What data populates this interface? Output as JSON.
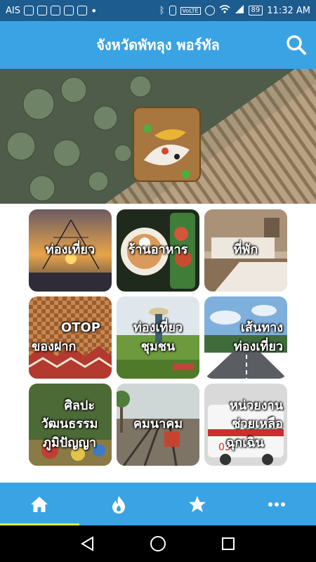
{
  "status": {
    "carrier": "AIS",
    "time": "11:32 AM",
    "battery": "89",
    "network_badge": "VoLTE"
  },
  "app": {
    "title": "จังหวัดพัทลุง พอร์ทัล"
  },
  "icons": {
    "search": "search-icon",
    "home": "home-icon",
    "trending": "flame-icon",
    "favorite": "star-icon",
    "more": "more-icon"
  },
  "menu": [
    {
      "lines": [
        "ท่องเที่ยว"
      ],
      "theme": "sunset"
    },
    {
      "lines": [
        "ร้านอาหาร"
      ],
      "theme": "food"
    },
    {
      "lines": [
        "ที่พัก"
      ],
      "theme": "room"
    },
    {
      "lines": [
        "OTOP",
        "ของฝาก"
      ],
      "theme": "weave"
    },
    {
      "lines": [
        "ท่องเที่ยว",
        "ชุมชน"
      ],
      "theme": "field"
    },
    {
      "lines": [
        "เส้นทาง",
        "ท่องเที่ยว"
      ],
      "theme": "road"
    },
    {
      "lines": [
        "ศิลปะ",
        "วัฒนธรรม",
        "ภูมิปัญญา"
      ],
      "theme": "art"
    },
    {
      "lines": [
        "คมนาคม"
      ],
      "theme": "rail"
    },
    {
      "lines": [
        "หน่วยงาน",
        "ช่วยเหลือ",
        "ฉุกเฉิน"
      ],
      "theme": "ambulance"
    }
  ],
  "colors": {
    "appbar": "#3aa3e3",
    "statusbar": "#1d5c8f",
    "active_indicator": "#d7f542"
  }
}
